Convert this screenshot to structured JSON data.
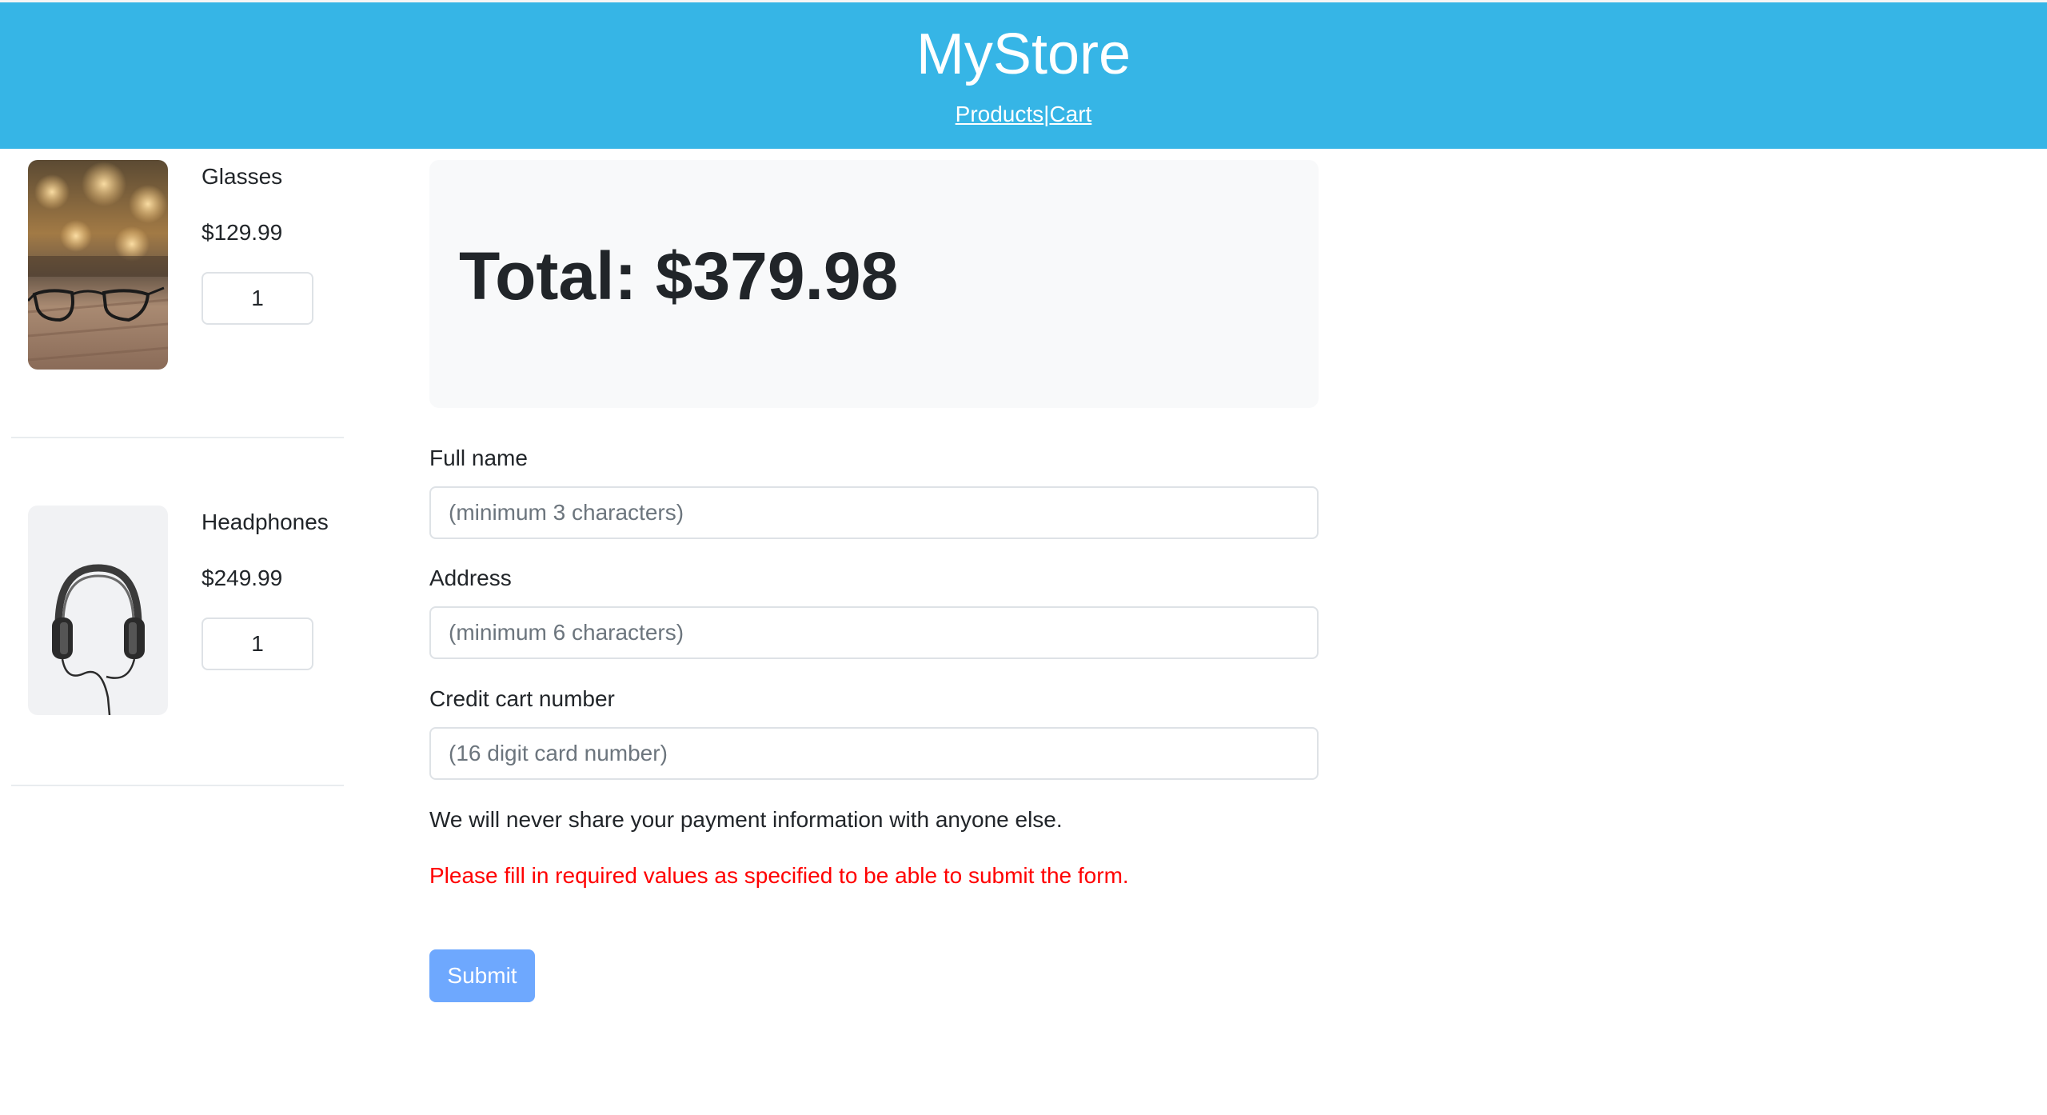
{
  "header": {
    "brand": "MyStore",
    "nav": {
      "products": "Products",
      "separator": "|",
      "cart": "Cart"
    },
    "background_color": "#36b5e6"
  },
  "cart": {
    "items": [
      {
        "name": "Glasses",
        "price": "$129.99",
        "quantity": "1",
        "image_icon": "glasses-photo"
      },
      {
        "name": "Headphones",
        "price": "$249.99",
        "quantity": "1",
        "image_icon": "headphones-photo"
      }
    ]
  },
  "summary": {
    "total": "Total: $379.98"
  },
  "form": {
    "full_name": {
      "label": "Full name",
      "placeholder": "(minimum 3 characters)",
      "value": ""
    },
    "address": {
      "label": "Address",
      "placeholder": "(minimum 6 characters)",
      "value": ""
    },
    "card": {
      "label": "Credit cart number",
      "placeholder": "(16 digit card number)",
      "value": ""
    },
    "help_text": "We will never share your payment information with anyone else.",
    "error_text": "Please fill in required values as specified to be able to submit the form.",
    "error_color": "#ff0000",
    "submit_label": "Submit",
    "submit_color": "#6ea8fe"
  }
}
